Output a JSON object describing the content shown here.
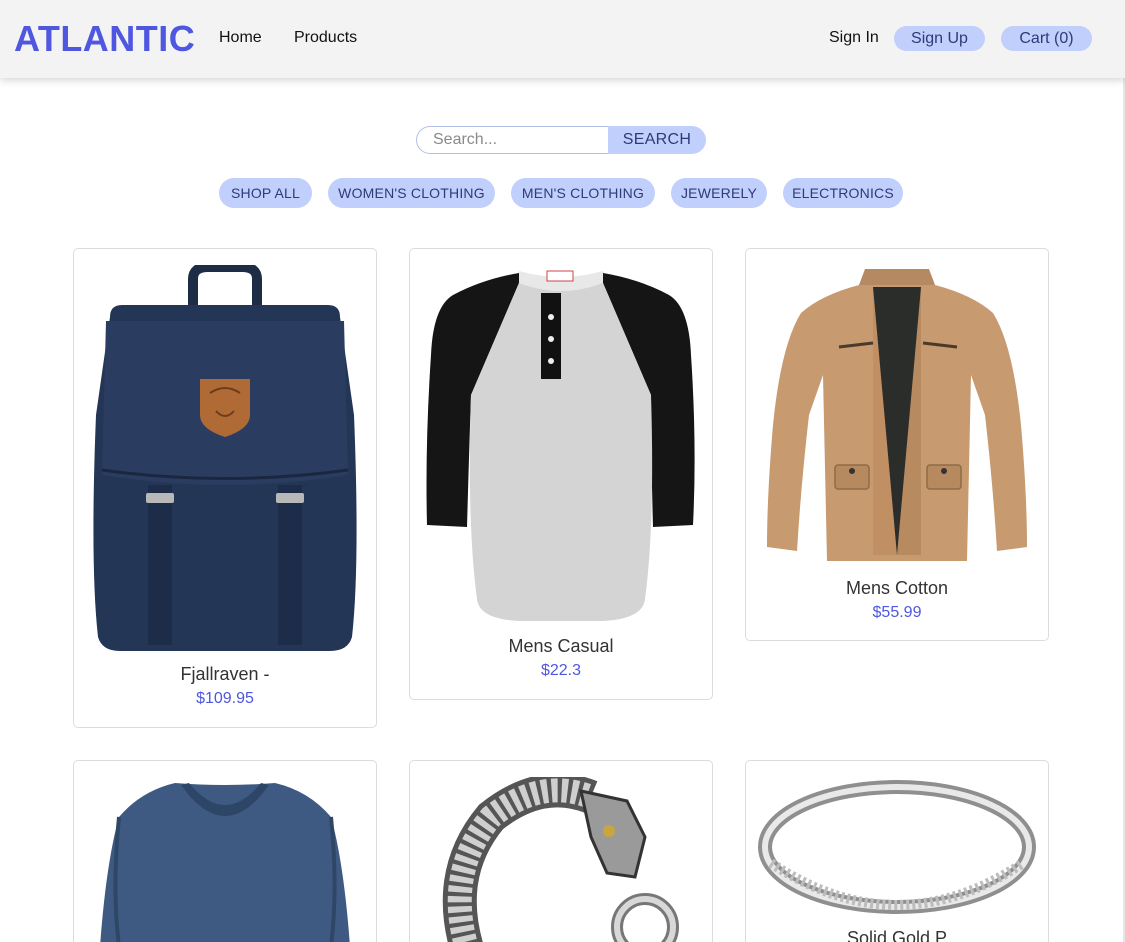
{
  "header": {
    "brand": "ATLANTIC",
    "nav": {
      "home": "Home",
      "products": "Products"
    },
    "sign_in": "Sign In",
    "sign_up": "Sign Up",
    "cart": "Cart (0)"
  },
  "search": {
    "placeholder": "Search...",
    "value": "",
    "button": "SEARCH"
  },
  "categories": [
    "SHOP ALL",
    "WOMEN'S CLOTHING",
    "MEN'S CLOTHING",
    "JEWERELY",
    "ELECTRONICS"
  ],
  "products": [
    {
      "title": "Fjallraven -",
      "price": "$109.95",
      "image": "backpack-image"
    },
    {
      "title": "Mens Casual",
      "price": "$22.3",
      "image": "raglan-shirt-image"
    },
    {
      "title": "Mens Cotton",
      "price": "$55.99",
      "image": "jacket-image"
    },
    {
      "title": "",
      "price": "",
      "image": "vneck-shirt-image"
    },
    {
      "title": "",
      "price": "",
      "image": "dragon-bracelet-image"
    },
    {
      "title": "Solid Gold P",
      "price": "",
      "image": "silver-ring-image"
    }
  ],
  "colors": {
    "brand": "#4f56e0",
    "pill": "#c0cffb",
    "pill_text": "#2f3a7a",
    "price": "#4f56e0"
  }
}
